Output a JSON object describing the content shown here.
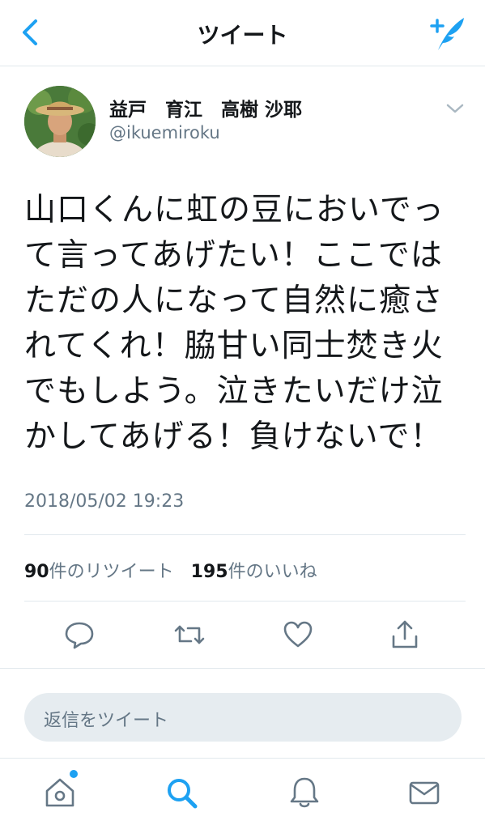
{
  "colors": {
    "accent": "#1da1f2",
    "text": "#14171a",
    "muted": "#657786",
    "divider": "#e1e8ed"
  },
  "header": {
    "title": "ツイート",
    "back_icon": "chevron-left-icon",
    "compose_icon": "compose-tweet-icon"
  },
  "user": {
    "name": "益戸　育江　高樹 沙耶",
    "handle": "@ikuemiroku"
  },
  "tweet": {
    "lines": [
      "山口くんに虹の豆においでっ",
      "て言ってあげたい！ここでは",
      "ただの人になって自然に癒さ",
      "れてくれ！脇甘い同士焚き火",
      "でもしよう。泣きたいだけ泣",
      "かしてあげる！負けないで！"
    ],
    "timestamp": "2018/05/02 19:23"
  },
  "stats": {
    "retweet_count": "90",
    "retweet_label": "件のリツイート",
    "like_count": "195",
    "like_label": "件のいいね"
  },
  "actions": [
    "reply-icon",
    "retweet-icon",
    "like-icon",
    "share-icon"
  ],
  "reply": {
    "placeholder": "返信をツイート"
  },
  "tabs": [
    "home-icon",
    "search-icon",
    "notifications-icon",
    "messages-icon"
  ]
}
